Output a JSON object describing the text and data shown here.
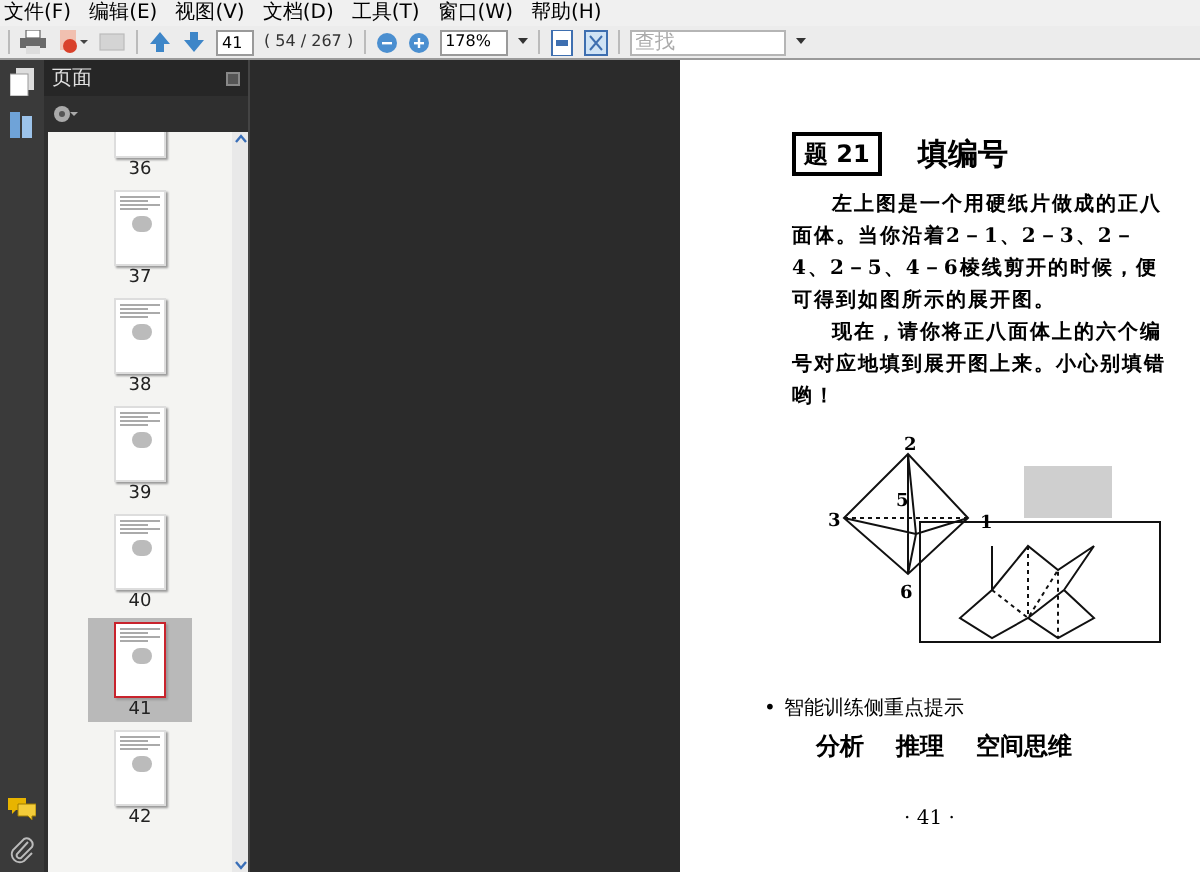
{
  "menu": [
    "文件(F)",
    "编辑(E)",
    "视图(V)",
    "文档(D)",
    "工具(T)",
    "窗口(W)",
    "帮助(H)"
  ],
  "toolbar": {
    "page_number": "41",
    "page_count": "( 54 / 267 )",
    "zoom": "178%",
    "search": {
      "placeholder": "查找"
    }
  },
  "pages_panel": {
    "title": "页面",
    "thumbnails": [
      {
        "label": "36",
        "selected": false
      },
      {
        "label": "37",
        "selected": false
      },
      {
        "label": "38",
        "selected": false
      },
      {
        "label": "39",
        "selected": false
      },
      {
        "label": "40",
        "selected": false
      },
      {
        "label": "41",
        "selected": true
      },
      {
        "label": "42",
        "selected": false
      }
    ]
  },
  "document": {
    "badge": "题 21",
    "title": "填编号",
    "paragraphs": [
      "左上图是一个用硬纸片做成的正八面体。当你沿着2－1、2－3、2－4、2－5、4－6棱线剪开的时候，便可得到如图所示的展开图。",
      "现在，请你将正八面体上的六个编号对应地填到展开图上来。小心别填错哟！"
    ],
    "figure_labels": [
      "2",
      "3",
      "5",
      "1",
      "6"
    ],
    "hint_bullet": "•",
    "hint_heading": "智能训练侧重点提示",
    "skills": [
      "分析",
      "推理",
      "空间思维"
    ],
    "page_footer": "· 41 ·"
  }
}
